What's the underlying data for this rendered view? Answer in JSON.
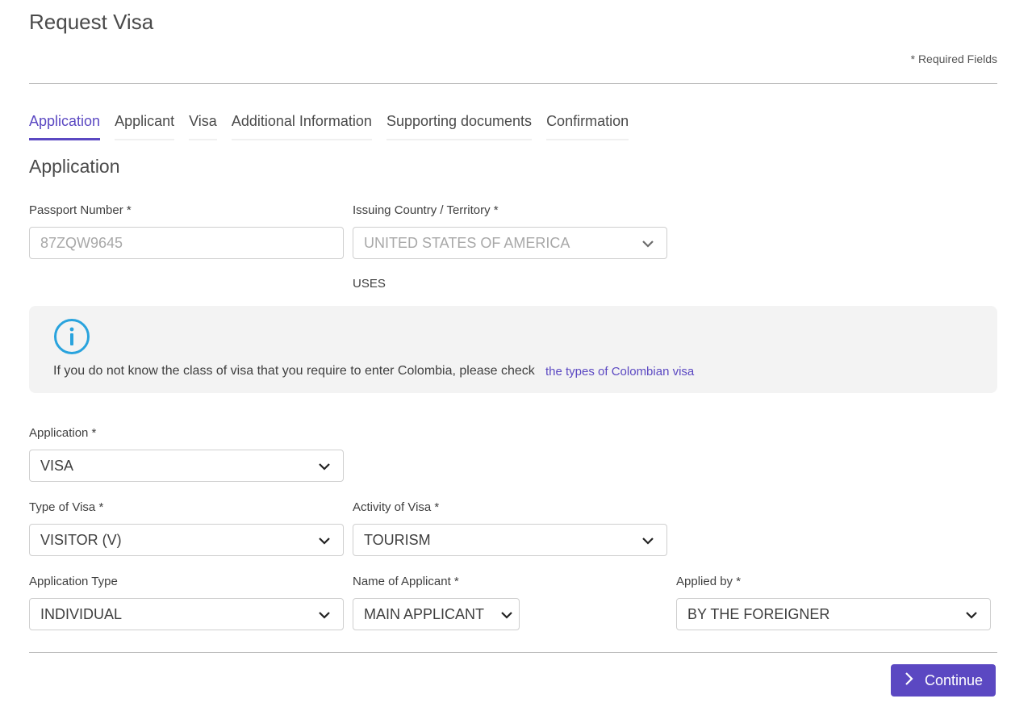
{
  "header": {
    "title": "Request Visa",
    "required_note": "* Required Fields"
  },
  "tabs": [
    {
      "label": "Application",
      "active": true
    },
    {
      "label": "Applicant",
      "active": false
    },
    {
      "label": "Visa",
      "active": false
    },
    {
      "label": "Additional Information",
      "active": false
    },
    {
      "label": "Supporting documents",
      "active": false
    },
    {
      "label": "Confirmation",
      "active": false
    }
  ],
  "section": {
    "title": "Application"
  },
  "passport": {
    "label": "Passport Number *",
    "value": "87ZQW9645"
  },
  "issuing_country": {
    "label": "Issuing Country / Territory *",
    "value": "UNITED STATES OF AMERICA",
    "code": "USES"
  },
  "info": {
    "text": "If you do not know the class of visa that you require to enter Colombia, please check",
    "link": "the types of Colombian visa"
  },
  "application": {
    "label": "Application *",
    "value": "VISA"
  },
  "type_of_visa": {
    "label": "Type of Visa *",
    "value": "VISITOR (V)"
  },
  "activity_of_visa": {
    "label": "Activity of Visa *",
    "value": "TOURISM"
  },
  "application_type": {
    "label": "Application Type",
    "value": "INDIVIDUAL"
  },
  "name_of_applicant": {
    "label": "Name of Applicant *",
    "value": "MAIN APPLICANT"
  },
  "applied_by": {
    "label": "Applied by *",
    "value": "BY THE FOREIGNER"
  },
  "footer": {
    "continue_label": "Continue"
  },
  "colors": {
    "accent": "#5b48c2",
    "info_icon": "#29a3dd"
  }
}
